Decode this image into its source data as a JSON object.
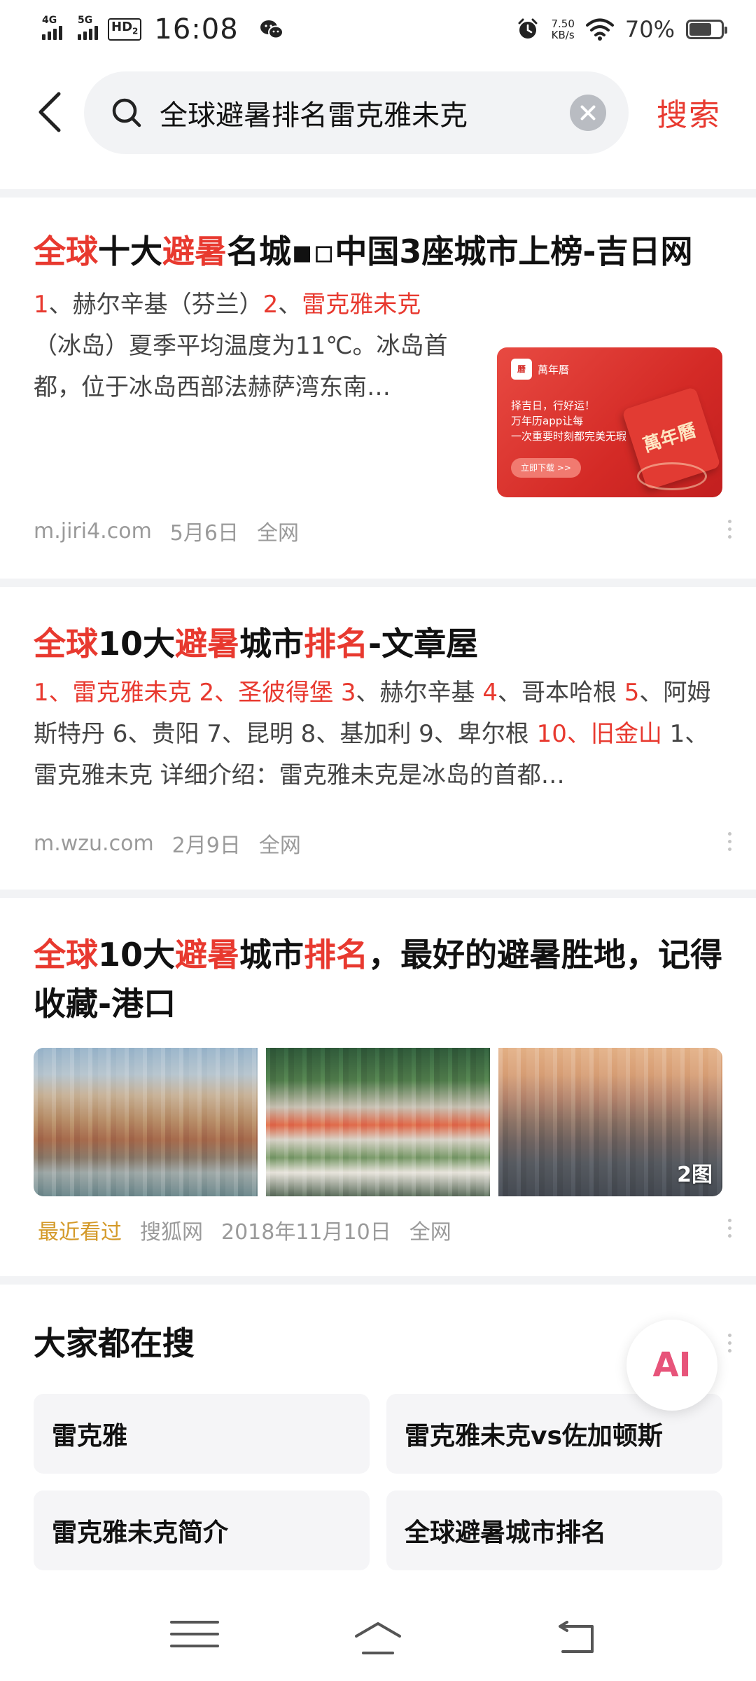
{
  "status_bar": {
    "network1": "4G",
    "network2": "5G",
    "hd": "HD",
    "hd_sub": "2",
    "time": "16:08",
    "speed_value": "7.50",
    "speed_unit": "KB/s",
    "battery_pct": "70%",
    "battery_level": 0.7,
    "icons": [
      "alarm-icon",
      "wifi-icon",
      "wechat-icon",
      "battery-icon"
    ]
  },
  "search": {
    "query": "全球避暑排名雷克雅未克",
    "submit_label": "搜索",
    "accent": "#e8392f"
  },
  "results": [
    {
      "title_parts": [
        "全球",
        "十大",
        "避暑",
        "名城▪▫中国3座城市上榜-吉日网"
      ],
      "snippet_parts": [
        "1",
        "、赫尔辛基（芬兰）",
        "2",
        "、",
        "雷克雅未克",
        "（冰岛）夏季平均温度为11℃。冰岛首都，位于冰岛西部法赫萨湾东南…"
      ],
      "thumb": {
        "brand": "萬年曆",
        "line1": "择吉日，行好运！",
        "line2": "万年历app让每",
        "line3": "一次重要时刻都完美无瑕",
        "button": "立即下载 >>",
        "badge": "萬年曆"
      },
      "source": "m.jiri4.com",
      "date": "5月6日",
      "scope": "全网"
    },
    {
      "title_parts": [
        "全球",
        "10大",
        "避暑",
        "城市",
        "排名",
        "-文章屋"
      ],
      "snippet_parts": [
        "1、雷克雅未克 2、圣彼得堡 3",
        "、赫尔辛基 ",
        "4",
        "、哥本哈根 ",
        "5",
        "、阿姆斯特丹 6、贵阳 7、昆明 8、基加利 9、卑尔根 ",
        "10、旧金山",
        " 1、雷克雅未克 详细介绍：雷克雅未克是冰岛的首都…"
      ],
      "source": "m.wzu.com",
      "date": "2月9日",
      "scope": "全网"
    },
    {
      "title_parts": [
        "全球",
        "10大",
        "避暑",
        "城市",
        "排名",
        "，最好的避暑胜地，记得收藏-港口"
      ],
      "photo_count": "2图",
      "recent": "最近看过",
      "source": "搜狐网",
      "date": "2018年11月10日",
      "scope": "全网"
    }
  ],
  "related": {
    "title": "大家都在搜",
    "items": [
      "雷克雅",
      "雷克雅未克vs佐加顿斯",
      "雷克雅未克简介",
      "全球避暑城市排名"
    ]
  },
  "ai_button": "AI"
}
